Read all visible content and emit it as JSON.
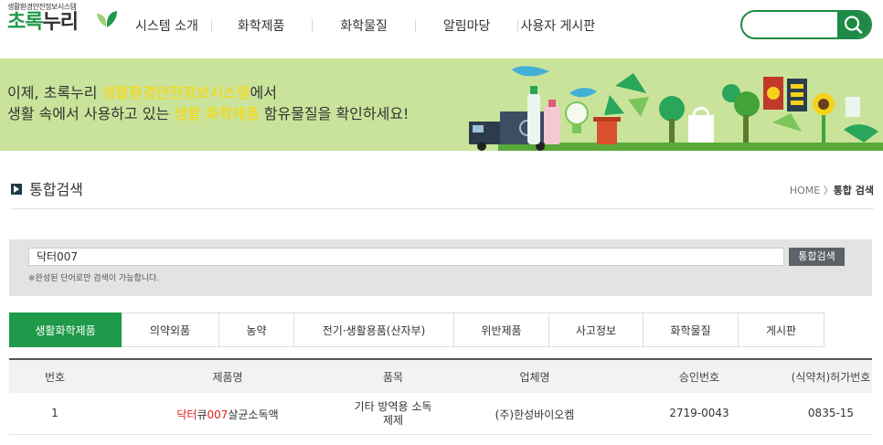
{
  "header": {
    "logo_subtitle": "생활환경안전정보시스템",
    "logo_title_part1": "초록",
    "logo_title_part2": "누리",
    "nav": [
      "시스템 소개",
      "화학제품",
      "화학물질",
      "알림마당",
      "사용자 게시판"
    ],
    "search_value": "",
    "search_icon": "search-icon"
  },
  "banner": {
    "line1_pre": "이제, 초록누리 ",
    "line1_highlight": "생활환경안전정보시스템",
    "line1_post": "에서",
    "line2_pre": "생활 속에서 사용하고 있는 ",
    "line2_highlight": "생활 화학제품",
    "line2_post": " 함유물질을 확인하세요!"
  },
  "page": {
    "title": "통합검색",
    "breadcrumb_home": "HOME",
    "breadcrumb_sep": "〉",
    "breadcrumb_current": "통합 검색"
  },
  "search": {
    "query": "닥터007",
    "button": "통합검색",
    "notice": "※완성된 단어로만 검색이 가능합니다."
  },
  "tabs": [
    "생활화학제품",
    "의약외품",
    "농약",
    "전기·생활용품(산자부)",
    "위반제품",
    "사고정보",
    "화학물질",
    "게시판"
  ],
  "active_tab": 0,
  "table": {
    "headers": [
      "번호",
      "제품명",
      "품목",
      "업체명",
      "승인번호",
      "(식약처)허가번호"
    ],
    "rows": [
      {
        "no": "1",
        "name_part1": "닥터",
        "name_part2": "큐",
        "name_part3": "007",
        "name_part4": "살균소독액",
        "item_line1": "기타 방역용 소독",
        "item_line2": "제제",
        "company": "(주)한성바이오켐",
        "approval": "2719-0043",
        "permit": "0835-15"
      }
    ]
  },
  "colors": {
    "brand_green": "#1f9a4a",
    "banner_bg": "#c9e49a",
    "highlight_yellow": "#ffd400",
    "search_match_red": "#e21e1e"
  }
}
